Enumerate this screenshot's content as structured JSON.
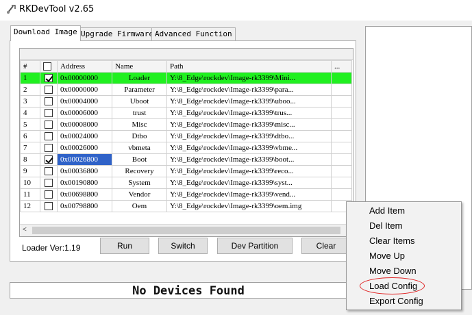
{
  "app": {
    "title": "RKDevTool v2.65",
    "icon": "app-icon"
  },
  "tabs": [
    {
      "label": "Download Image",
      "active": true
    },
    {
      "label": "Upgrade Firmware",
      "active": false
    },
    {
      "label": "Advanced Function",
      "active": false
    }
  ],
  "grid": {
    "headers": {
      "num": "#",
      "check": "☐",
      "address": "Address",
      "name": "Name",
      "path": "Path",
      "more": "..."
    },
    "rows": [
      {
        "num": "1",
        "checked": true,
        "address": "0x00000000",
        "name": "Loader",
        "path": "Y:\\8_Edge\\rockdev\\Image-rk3399\\Mini..."
      },
      {
        "num": "2",
        "checked": false,
        "address": "0x00000000",
        "name": "Parameter",
        "path": "Y:\\8_Edge\\rockdev\\Image-rk3399\\para..."
      },
      {
        "num": "3",
        "checked": false,
        "address": "0x00004000",
        "name": "Uboot",
        "path": "Y:\\8_Edge\\rockdev\\Image-rk3399\\uboo..."
      },
      {
        "num": "4",
        "checked": false,
        "address": "0x00006000",
        "name": "trust",
        "path": "Y:\\8_Edge\\rockdev\\Image-rk3399\\trus..."
      },
      {
        "num": "5",
        "checked": false,
        "address": "0x00008000",
        "name": "Misc",
        "path": "Y:\\8_Edge\\rockdev\\Image-rk3399\\misc..."
      },
      {
        "num": "6",
        "checked": false,
        "address": "0x00024000",
        "name": "Dtbo",
        "path": "Y:\\8_Edge\\rockdev\\Image-rk3399\\dtbo..."
      },
      {
        "num": "7",
        "checked": false,
        "address": "0x00026000",
        "name": "vbmeta",
        "path": "Y:\\8_Edge\\rockdev\\Image-rk3399\\vbme..."
      },
      {
        "num": "8",
        "checked": true,
        "address": "0x00026800",
        "name": "Boot",
        "path": "Y:\\8_Edge\\rockdev\\Image-rk3399\\boot..."
      },
      {
        "num": "9",
        "checked": false,
        "address": "0x00036800",
        "name": "Recovery",
        "path": "Y:\\8_Edge\\rockdev\\Image-rk3399\\reco..."
      },
      {
        "num": "10",
        "checked": false,
        "address": "0x00190800",
        "name": "System",
        "path": "Y:\\8_Edge\\rockdev\\Image-rk3399\\syst..."
      },
      {
        "num": "11",
        "checked": false,
        "address": "0x00698800",
        "name": "Vendor",
        "path": "Y:\\8_Edge\\rockdev\\Image-rk3399\\vend..."
      },
      {
        "num": "12",
        "checked": false,
        "address": "0x00798800",
        "name": "Oem",
        "path": "Y:\\8_Edge\\rockdev\\Image-rk3399\\oem.img"
      }
    ],
    "highlighted_row": "1",
    "selected_address_row": "8",
    "highlight_color": "#20f020",
    "selection_color": "#2f62c8"
  },
  "scroll_left_icon": "chevron-left-icon",
  "loader_version": "Loader Ver:1.19",
  "buttons": {
    "run": "Run",
    "switch": "Switch",
    "dev_partition": "Dev Partition",
    "clear": "Clear"
  },
  "status": "No Devices Found",
  "context_menu": {
    "items": [
      "Add Item",
      "Del Item",
      "Clear Items",
      "Move Up",
      "Move Down",
      "Load Config",
      "Export Config"
    ],
    "circled_item": "Load Config",
    "circle_color": "#e02020"
  }
}
